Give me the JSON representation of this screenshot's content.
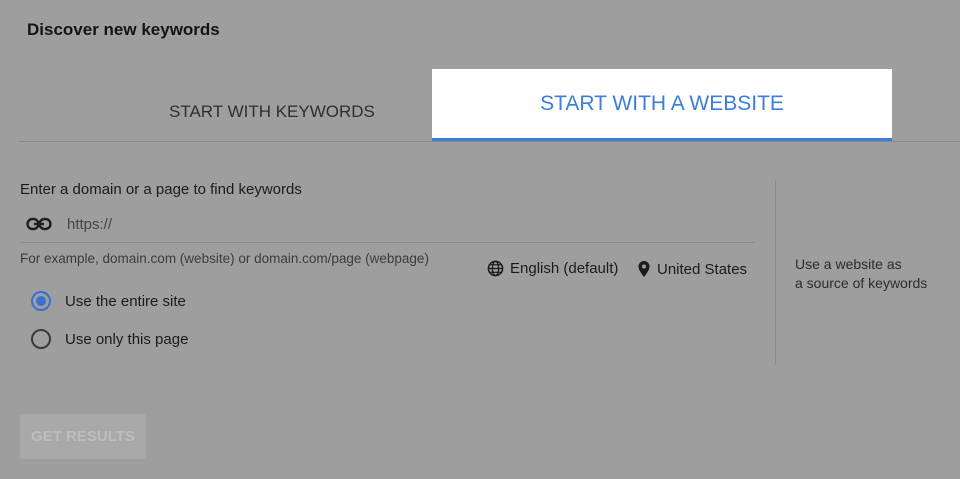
{
  "header": {
    "title": "Discover new keywords"
  },
  "tabs": [
    {
      "label": "START WITH KEYWORDS",
      "active": false
    },
    {
      "label": "START WITH A WEBSITE",
      "active": true
    }
  ],
  "form": {
    "label": "Enter a domain or a page to find keywords",
    "url_placeholder": "https://",
    "url_value": "",
    "hint": "For example, domain.com (website) or domain.com/page (webpage)",
    "language": "English (default)",
    "location": "United States",
    "scope_options": [
      {
        "label": "Use the entire site",
        "checked": true
      },
      {
        "label": "Use only this page",
        "checked": false
      }
    ],
    "submit_label": "GET RESULTS"
  },
  "side_note": {
    "line1": "Use a website as",
    "line2": "a source of keywords"
  },
  "colors": {
    "accent": "#3b7ddd",
    "overlay": "#9e9e9e"
  },
  "icons": {
    "url": "link-icon",
    "language": "globe-icon",
    "location": "location-pin-icon"
  }
}
